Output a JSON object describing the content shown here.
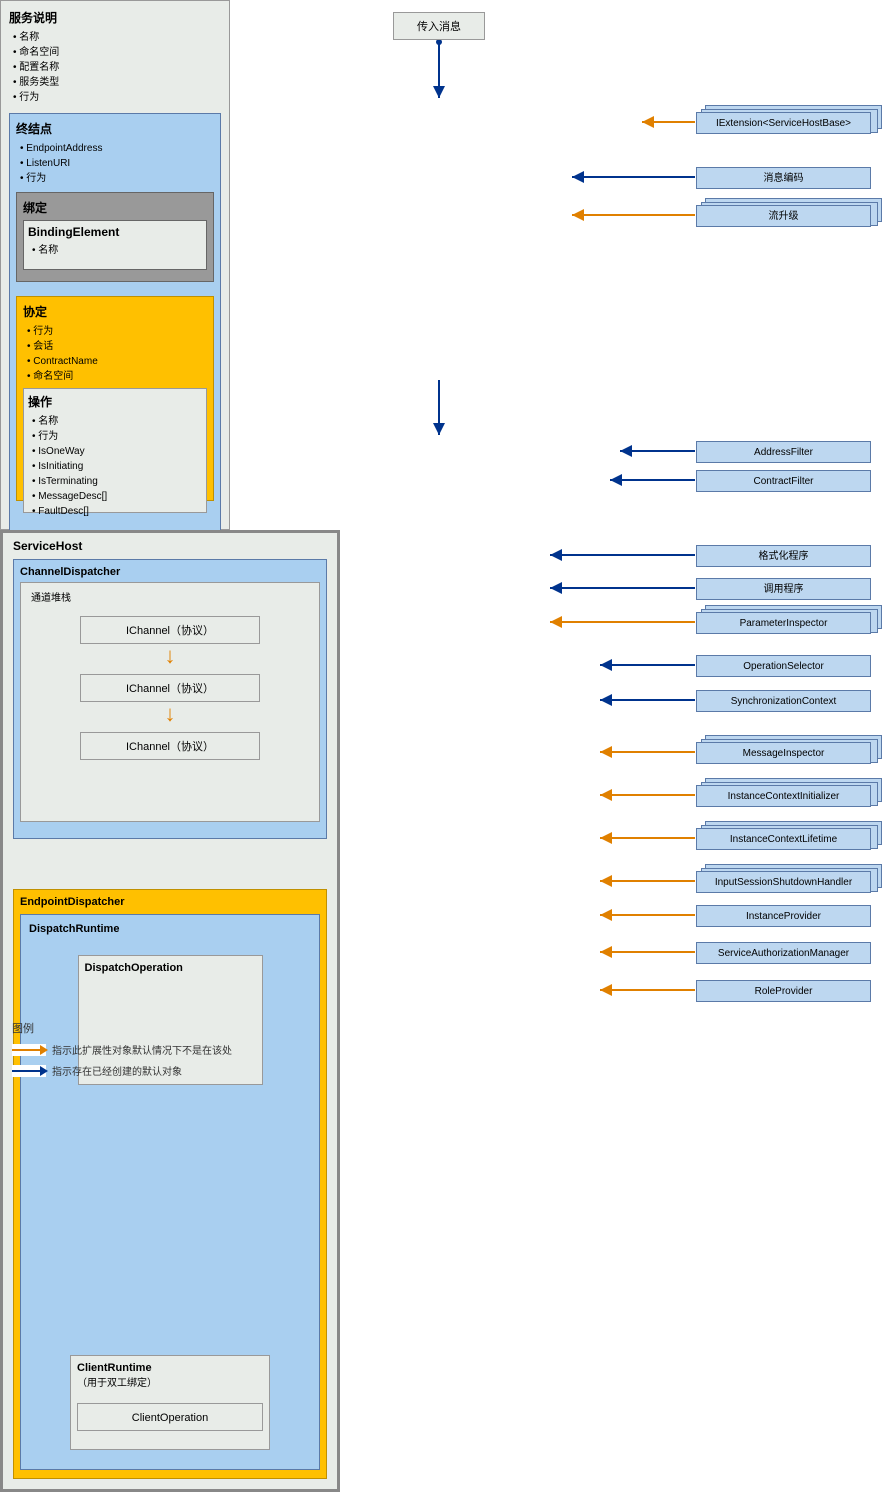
{
  "incoming": "传入消息",
  "svcDesc": {
    "title": "服务说明",
    "items": [
      "名称",
      "命名空间",
      "配置名称",
      "服务类型",
      "行为"
    ],
    "endpoint": {
      "title": "终结点",
      "items": [
        "EndpointAddress",
        "ListenURI",
        "行为"
      ],
      "binding": {
        "title": "绑定",
        "el": {
          "title": "BindingElement",
          "items": [
            "名称"
          ]
        }
      },
      "contract": {
        "title": "协定",
        "items": [
          "行为",
          "会话",
          "ContractName",
          "命名空间"
        ],
        "op": {
          "title": "操作",
          "items": [
            "名称",
            "行为",
            "IsOneWay",
            "IsInitiating",
            "IsTerminating",
            "MessageDesc[]",
            "FaultDesc[]"
          ]
        }
      }
    }
  },
  "serviceHost": {
    "title": "ServiceHost",
    "chanDisp": "ChannelDispatcher",
    "chanStack": "通道堆栈",
    "ichan": "IChannel（协议）",
    "epDisp": "EndpointDispatcher",
    "dispRt": "DispatchRuntime",
    "dispOp": "DispatchOperation",
    "clientRt": "ClientRuntime",
    "clientRtSub": "（用于双工绑定）",
    "clientOp": "ClientOperation"
  },
  "ext": {
    "iext": "IExtension<ServiceHostBase>",
    "msgEnc": "消息编码",
    "stream": "流升级",
    "addrFilter": "AddressFilter",
    "contrFilter": "ContractFilter",
    "formatter": "格式化程序",
    "invoker": "调用程序",
    "paramInsp": "ParameterInspector",
    "opSel": "OperationSelector",
    "syncCtx": "SynchronizationContext",
    "msgInsp": "MessageInspector",
    "instInit": "InstanceContextInitializer",
    "instLife": "InstanceContextLifetime",
    "inputSess": "InputSessionShutdownHandler",
    "instProv": "InstanceProvider",
    "svcAuth": "ServiceAuthorizationManager",
    "roleProv": "RoleProvider"
  },
  "legend": {
    "title": "图例",
    "orange": "指示此扩展性对象默认情况下不是在该处",
    "blue": "指示存在已经创建的默认对象"
  }
}
